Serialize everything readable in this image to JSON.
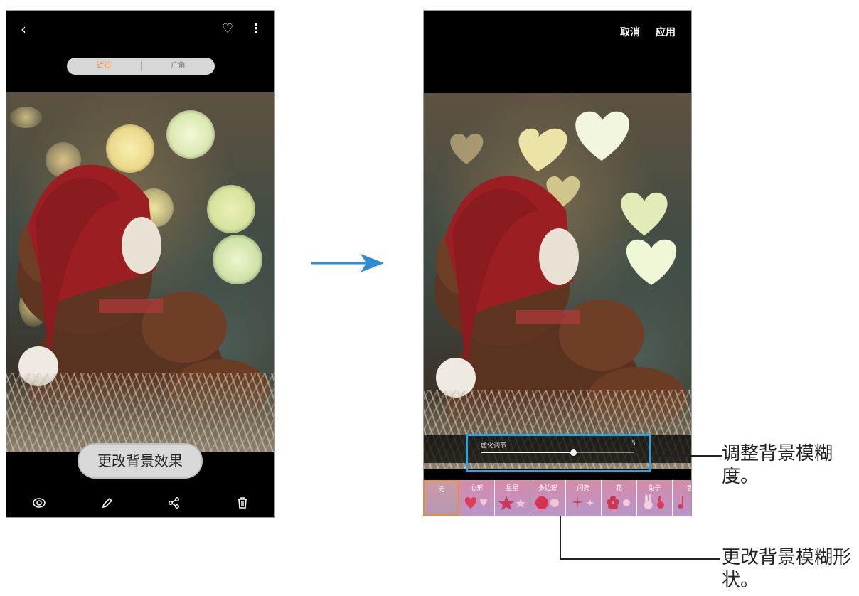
{
  "left_screen": {
    "mode_tabs": [
      "近拍",
      "广角"
    ],
    "change_effect_button": "更改背景效果"
  },
  "right_screen": {
    "cancel_label": "取消",
    "apply_label": "应用",
    "blur_label": "虚化调节",
    "blur_value": "5",
    "blur_level_fraction": 0.6,
    "shapes": [
      "无",
      "心形",
      "星星",
      "多边形",
      "闪亮",
      "花",
      "兔子",
      "音"
    ]
  },
  "callouts": {
    "adjust_blur": "调整背景模糊度。",
    "change_shape": "更改背景模糊形状。"
  },
  "colors": {
    "accent_orange": "#f08a2b",
    "callout_blue": "#29a6e2",
    "arrow_blue": "#2f8ccf"
  },
  "icons": [
    "back-icon",
    "heart-icon",
    "more-vert-icon",
    "eye-icon",
    "pencil-icon",
    "share-icon",
    "trash-icon"
  ]
}
